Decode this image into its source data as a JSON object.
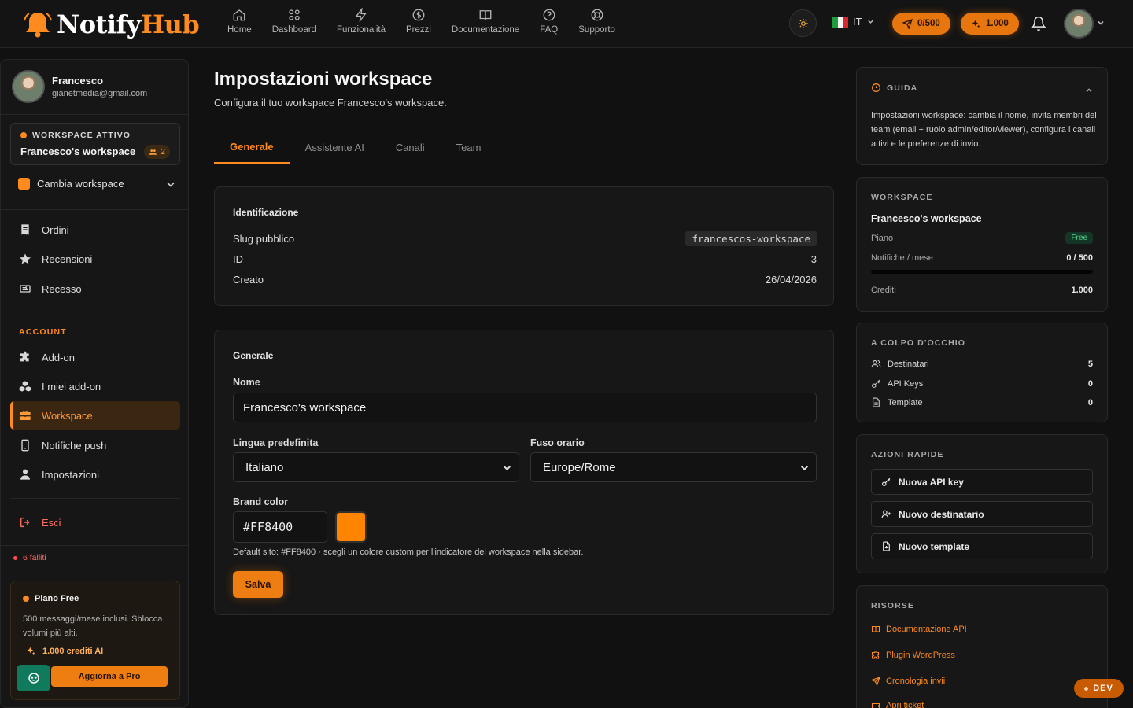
{
  "brand": {
    "name_part1": "Notify",
    "name_part2": "Hub",
    "accent": "#FF8400"
  },
  "nav": [
    {
      "label": "Home",
      "icon": "home-icon"
    },
    {
      "label": "Dashboard",
      "icon": "dashboard-icon"
    },
    {
      "label": "Funzionalità",
      "icon": "bolt-icon"
    },
    {
      "label": "Prezzi",
      "icon": "dollar-icon"
    },
    {
      "label": "Documentazione",
      "icon": "book-icon"
    },
    {
      "label": "FAQ",
      "icon": "help-icon"
    },
    {
      "label": "Supporto",
      "icon": "lifebuoy-icon"
    }
  ],
  "topbar": {
    "language": "IT",
    "quota_pill": "0/500",
    "credits_pill": "1.000"
  },
  "user": {
    "name": "Francesco",
    "email": "gianetmedia@gmail.com"
  },
  "sidebar": {
    "active_workspace_label": "WORKSPACE ATTIVO",
    "workspace_name": "Francesco's workspace",
    "member_count": "2",
    "switch_label": "Cambia workspace",
    "items_top": [
      {
        "label": "Ordini",
        "icon": "receipt-icon"
      },
      {
        "label": "Recensioni",
        "icon": "star-icon"
      },
      {
        "label": "Recesso",
        "icon": "return-icon"
      }
    ],
    "account_label": "ACCOUNT",
    "items_account": [
      {
        "label": "Add-on",
        "icon": "puzzle-icon"
      },
      {
        "label": "I miei add-on",
        "icon": "cubes-icon"
      },
      {
        "label": "Workspace",
        "icon": "briefcase-icon"
      },
      {
        "label": "Notifiche push",
        "icon": "phone-icon"
      },
      {
        "label": "Impostazioni",
        "icon": "user-icon"
      }
    ],
    "logout_label": "Esci",
    "failed_label": "6 falliti",
    "plan": {
      "title": "Piano Free",
      "description": "500 messaggi/mese inclusi. Sblocca volumi più alti.",
      "credits": "1.000 crediti AI",
      "upgrade_label": "Aggiorna a Pro"
    }
  },
  "main": {
    "title": "Impostazioni workspace",
    "subtitle": "Configura il tuo workspace Francesco's workspace.",
    "tabs": [
      {
        "label": "Generale"
      },
      {
        "label": "Assistente AI"
      },
      {
        "label": "Canali"
      },
      {
        "label": "Team"
      }
    ],
    "identification": {
      "title": "Identificazione",
      "rows": [
        {
          "label": "Slug pubblico",
          "value": "francescos-workspace"
        },
        {
          "label": "ID",
          "value": "3"
        },
        {
          "label": "Creato",
          "value": "26/04/2026"
        }
      ]
    },
    "general": {
      "title": "Generale",
      "name_label": "Nome",
      "name_value": "Francesco's workspace",
      "language_label": "Lingua predefinita",
      "language_value": "Italiano",
      "timezone_label": "Fuso orario",
      "timezone_value": "Europe/Rome",
      "brand_color_label": "Brand color",
      "brand_color_value": "#FF8400",
      "hint": "Default sito: #FF8400 · scegli un colore custom per l'indicatore del workspace nella sidebar.",
      "save_label": "Salva"
    }
  },
  "rail": {
    "guide": {
      "title": "GUIDA",
      "text": "Impostazioni workspace: cambia il nome, invita membri del team (email + ruolo admin/editor/viewer), configura i canali attivi e le preferenze di invio."
    },
    "workspace": {
      "label": "WORKSPACE",
      "name": "Francesco's workspace",
      "plan_label": "Piano",
      "plan_value": "Free",
      "notif_label": "Notifiche / mese",
      "notif_value": "0 / 500",
      "notif_fraction": 0,
      "credits_label": "Crediti",
      "credits_value": "1.000"
    },
    "glance": {
      "label": "A COLPO D'OCCHIO",
      "rows": [
        {
          "label": "Destinatari",
          "value": "5",
          "icon": "users-icon"
        },
        {
          "label": "API Keys",
          "value": "0",
          "icon": "key-icon"
        },
        {
          "label": "Template",
          "value": "0",
          "icon": "file-icon"
        }
      ]
    },
    "quick": {
      "label": "AZIONI RAPIDE",
      "buttons": [
        {
          "label": "Nuova API key",
          "icon": "key-icon"
        },
        {
          "label": "Nuovo destinatario",
          "icon": "user-plus-icon"
        },
        {
          "label": "Nuovo template",
          "icon": "file-plus-icon"
        }
      ]
    },
    "resources": {
      "label": "RISORSE",
      "links": [
        {
          "label": "Documentazione API",
          "icon": "book-icon"
        },
        {
          "label": "Plugin WordPress",
          "icon": "plugin-icon"
        },
        {
          "label": "Cronologia invii",
          "icon": "send-icon"
        },
        {
          "label": "Apri ticket",
          "icon": "ticket-icon"
        }
      ]
    }
  },
  "dev_badge": "DEV"
}
